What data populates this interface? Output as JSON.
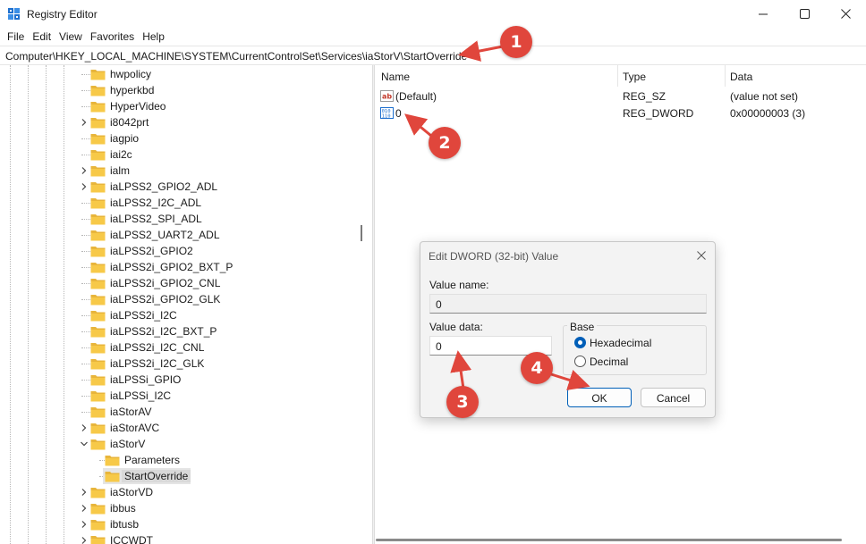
{
  "window": {
    "title": "Registry Editor",
    "controls": [
      "minimize-icon",
      "maximize-icon",
      "close-icon"
    ]
  },
  "menu": [
    "File",
    "Edit",
    "View",
    "Favorites",
    "Help"
  ],
  "address": "Computer\\HKEY_LOCAL_MACHINE\\SYSTEM\\CurrentControlSet\\Services\\iaStorV\\StartOverride",
  "tree": [
    {
      "label": "hwpolicy",
      "expandable": false
    },
    {
      "label": "hyperkbd",
      "expandable": false
    },
    {
      "label": "HyperVideo",
      "expandable": false
    },
    {
      "label": "i8042prt",
      "expandable": true
    },
    {
      "label": "iagpio",
      "expandable": false
    },
    {
      "label": "iai2c",
      "expandable": false
    },
    {
      "label": "ialm",
      "expandable": true
    },
    {
      "label": "iaLPSS2_GPIO2_ADL",
      "expandable": true
    },
    {
      "label": "iaLPSS2_I2C_ADL",
      "expandable": false
    },
    {
      "label": "iaLPSS2_SPI_ADL",
      "expandable": false
    },
    {
      "label": "iaLPSS2_UART2_ADL",
      "expandable": false
    },
    {
      "label": "iaLPSS2i_GPIO2",
      "expandable": false
    },
    {
      "label": "iaLPSS2i_GPIO2_BXT_P",
      "expandable": false
    },
    {
      "label": "iaLPSS2i_GPIO2_CNL",
      "expandable": false
    },
    {
      "label": "iaLPSS2i_GPIO2_GLK",
      "expandable": false
    },
    {
      "label": "iaLPSS2i_I2C",
      "expandable": false
    },
    {
      "label": "iaLPSS2i_I2C_BXT_P",
      "expandable": false
    },
    {
      "label": "iaLPSS2i_I2C_CNL",
      "expandable": false
    },
    {
      "label": "iaLPSS2i_I2C_GLK",
      "expandable": false
    },
    {
      "label": "iaLPSSi_GPIO",
      "expandable": false
    },
    {
      "label": "iaLPSSi_I2C",
      "expandable": false
    },
    {
      "label": "iaStorAV",
      "expandable": false
    },
    {
      "label": "iaStorAVC",
      "expandable": true
    },
    {
      "label": "iaStorV",
      "expandable": true,
      "expanded": true
    },
    {
      "label": "Parameters",
      "expandable": false,
      "child": true
    },
    {
      "label": "StartOverride",
      "expandable": false,
      "child": true,
      "selected": true
    },
    {
      "label": "iaStorVD",
      "expandable": true
    },
    {
      "label": "ibbus",
      "expandable": true
    },
    {
      "label": "ibtusb",
      "expandable": true
    },
    {
      "label": "ICCWDT",
      "expandable": true
    }
  ],
  "list": {
    "headers": [
      "Name",
      "Type",
      "Data"
    ],
    "rows": [
      {
        "icon": "string-value-icon",
        "name": "(Default)",
        "type": "REG_SZ",
        "data": "(value not set)"
      },
      {
        "icon": "binary-value-icon",
        "name": "0",
        "type": "REG_DWORD",
        "data": "0x00000003 (3)"
      }
    ]
  },
  "dialog": {
    "title": "Edit DWORD (32-bit) Value",
    "value_name_label": "Value name:",
    "value_name": "0",
    "value_data_label": "Value data:",
    "value_data": "0",
    "base_label": "Base",
    "base_options": [
      {
        "label": "Hexadecimal",
        "selected": true
      },
      {
        "label": "Decimal",
        "selected": false
      }
    ],
    "ok_label": "OK",
    "cancel_label": "Cancel"
  },
  "callouts": [
    "1",
    "2",
    "3",
    "4"
  ],
  "colors": {
    "callout": "#e0463c",
    "accent": "#005fb8",
    "folder": "#f7c948"
  }
}
